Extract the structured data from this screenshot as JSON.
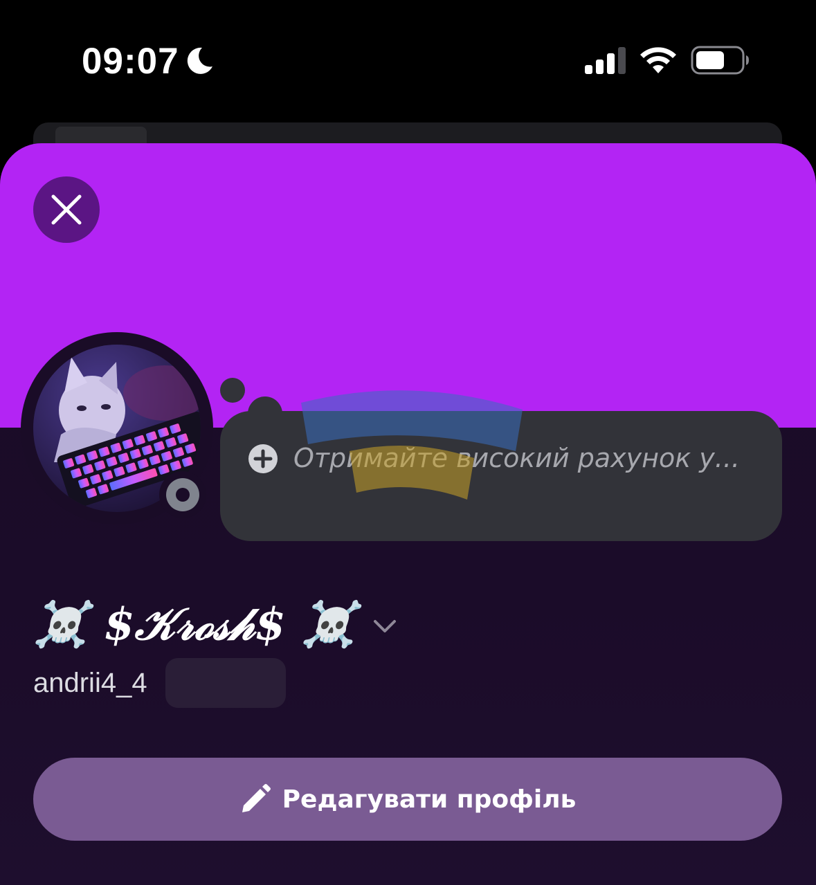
{
  "status_bar": {
    "time": "09:07",
    "icons": [
      "moon-icon",
      "cellular-signal-icon",
      "wifi-icon",
      "battery-icon"
    ]
  },
  "profile": {
    "banner_color": "#b324f4",
    "close_icon": "close-icon",
    "status_placeholder": "Отримайте високий рахунок у...",
    "display_name": "☠️ $𝒦𝓇ℴ𝓈𝒽$ ☠️",
    "username": "andrii4_4",
    "edit_button_label": "Редагувати профіль",
    "edit_icon": "pencil-icon",
    "presence": "offline"
  },
  "colors": {
    "sheet_background": "#1a0c27",
    "bubble": "#323339",
    "edit_button": "#7a5b93"
  }
}
